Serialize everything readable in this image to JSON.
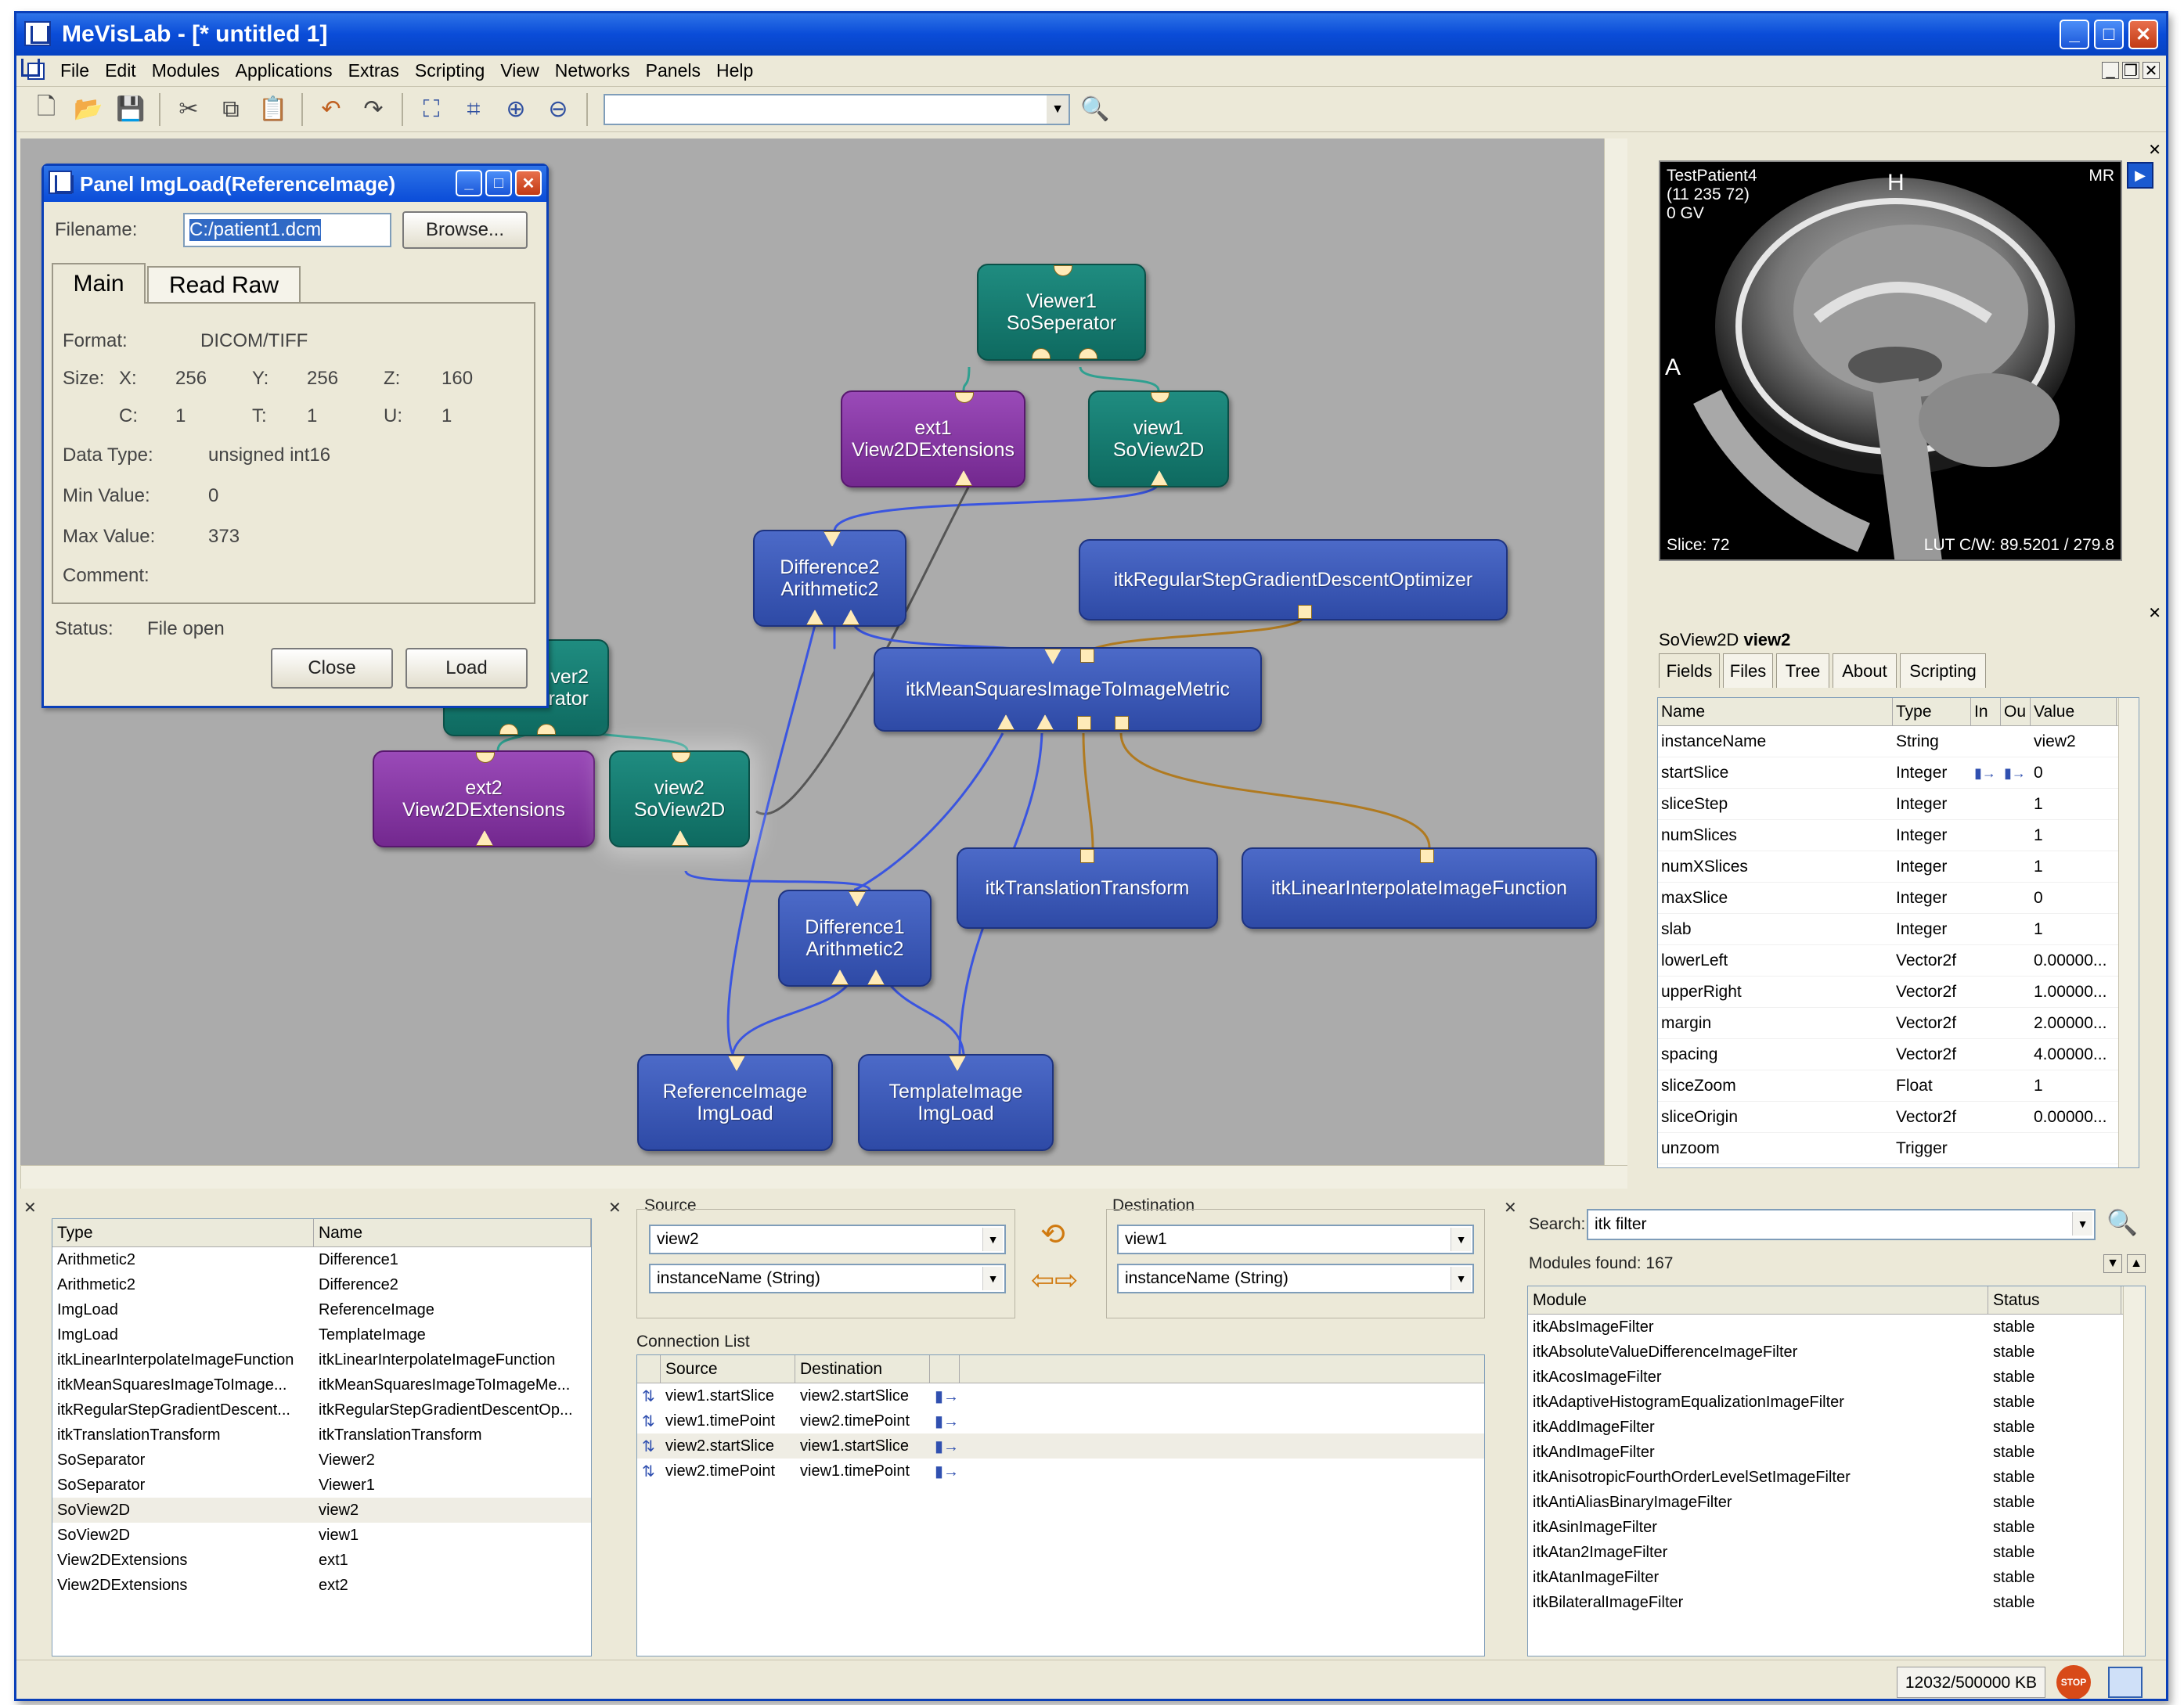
{
  "window": {
    "title": "MeVisLab - [* untitled 1]"
  },
  "menu": [
    "File",
    "Edit",
    "Modules",
    "Applications",
    "Extras",
    "Scripting",
    "View",
    "Networks",
    "Panels",
    "Help"
  ],
  "panel": {
    "title": "Panel ImgLoad(ReferenceImage)",
    "filename_label": "Filename:",
    "filename_value": "C:/patient1.dcm",
    "browse": "Browse...",
    "tabs": [
      "Main",
      "Read Raw"
    ],
    "format_label": "Format:",
    "format_value": "DICOM/TIFF",
    "size_label": "Size:",
    "x_label": "X:",
    "x": "256",
    "y_label": "Y:",
    "y": "256",
    "z_label": "Z:",
    "z": "160",
    "c_label": "C:",
    "c": "1",
    "t_label": "T:",
    "t": "1",
    "u_label": "U:",
    "u": "1",
    "datatype_label": "Data Type:",
    "datatype": "unsigned int16",
    "min_label": "Min Value:",
    "min": "0",
    "max_label": "Max Value:",
    "max": "373",
    "comment_label": "Comment:",
    "status_label": "Status:",
    "status": "File open",
    "close": "Close",
    "load": "Load"
  },
  "network": {
    "modules": [
      {
        "id": "viewer1",
        "l1": "Viewer1",
        "l2": "SoSeperator",
        "kind": "teal"
      },
      {
        "id": "ext1",
        "l1": "ext1",
        "l2": "View2DExtensions",
        "kind": "purple"
      },
      {
        "id": "view1",
        "l1": "view1",
        "l2": "SoView2D",
        "kind": "teal"
      },
      {
        "id": "diff2",
        "l1": "Difference2",
        "l2": "Arithmetic2",
        "kind": "blue"
      },
      {
        "id": "optimizer",
        "l1": "itkRegularStepGradientDescentOptimizer",
        "l2": "",
        "kind": "blue"
      },
      {
        "id": "metric",
        "l1": "itkMeanSquaresImageToImageMetric",
        "l2": "",
        "kind": "blue"
      },
      {
        "id": "viewer2",
        "l1": "ver2",
        "l2": "arator",
        "kind": "teal"
      },
      {
        "id": "ext2",
        "l1": "ext2",
        "l2": "View2DExtensions",
        "kind": "purple"
      },
      {
        "id": "view2",
        "l1": "view2",
        "l2": "SoView2D",
        "kind": "teal"
      },
      {
        "id": "translation",
        "l1": "itkTranslationTransform",
        "l2": "",
        "kind": "blue"
      },
      {
        "id": "interp",
        "l1": "itkLinearInterpolateImageFunction",
        "l2": "",
        "kind": "blue"
      },
      {
        "id": "diff1",
        "l1": "Difference1",
        "l2": "Arithmetic2",
        "kind": "blue"
      },
      {
        "id": "refimg",
        "l1": "ReferenceImage",
        "l2": "ImgLoad",
        "kind": "blue"
      },
      {
        "id": "tmplimg",
        "l1": "TemplateImage",
        "l2": "ImgLoad",
        "kind": "blue"
      }
    ]
  },
  "viewer": {
    "patient": "TestPatient4",
    "dims": "(11 235 72)",
    "gv": "0 GV",
    "modality": "MR",
    "orient_h": "H",
    "orient_a": "A",
    "slice": "Slice: 72",
    "lut": "LUT C/W: 89.5201 / 279.8"
  },
  "inspector": {
    "title_type": "SoView2D",
    "title_name": "view2",
    "tabs": [
      "Fields",
      "Files",
      "Tree",
      "About",
      "Scripting"
    ],
    "columns": [
      "Name",
      "Type",
      "In",
      "Ou",
      "Value"
    ],
    "rows": [
      [
        "instanceName",
        "String",
        "view2"
      ],
      [
        "startSlice",
        "Integer",
        "0"
      ],
      [
        "sliceStep",
        "Integer",
        "1"
      ],
      [
        "numSlices",
        "Integer",
        "1"
      ],
      [
        "numXSlices",
        "Integer",
        "1"
      ],
      [
        "maxSlice",
        "Integer",
        "0"
      ],
      [
        "slab",
        "Integer",
        "1"
      ],
      [
        "lowerLeft",
        "Vector2f",
        "0.00000..."
      ],
      [
        "upperRight",
        "Vector2f",
        "1.00000..."
      ],
      [
        "margin",
        "Vector2f",
        "2.00000..."
      ],
      [
        "spacing",
        "Vector2f",
        "4.00000..."
      ],
      [
        "sliceZoom",
        "Float",
        "1"
      ],
      [
        "sliceOrigin",
        "Vector2f",
        "0.00000..."
      ],
      [
        "unzoom",
        "Trigger",
        ""
      ]
    ]
  },
  "modlist": {
    "columns": [
      "Type",
      "Name"
    ],
    "rows": [
      [
        "Arithmetic2",
        "Difference1"
      ],
      [
        "Arithmetic2",
        "Difference2"
      ],
      [
        "ImgLoad",
        "ReferenceImage"
      ],
      [
        "ImgLoad",
        "TemplateImage"
      ],
      [
        "itkLinearInterpolateImageFunction",
        "itkLinearInterpolateImageFunction"
      ],
      [
        "itkMeanSquaresImageToImage...",
        "itkMeanSquaresImageToImageMe..."
      ],
      [
        "itkRegularStepGradientDescent...",
        "itkRegularStepGradientDescentOp..."
      ],
      [
        "itkTranslationTransform",
        "itkTranslationTransform"
      ],
      [
        "SoSeparator",
        "Viewer2"
      ],
      [
        "SoSeparator",
        "Viewer1"
      ],
      [
        "SoView2D",
        "view2"
      ],
      [
        "SoView2D",
        "view1"
      ],
      [
        "View2DExtensions",
        "ext1"
      ],
      [
        "View2DExtensions",
        "ext2"
      ]
    ]
  },
  "connections": {
    "source_label": "Source",
    "dest_label": "Destination",
    "source_module": "view2",
    "source_field": "instanceName (String)",
    "dest_module": "view1",
    "dest_field": "instanceName (String)",
    "list_label": "Connection List",
    "columns": [
      "Source",
      "Destination"
    ],
    "rows": [
      [
        "view1.startSlice",
        "view2.startSlice"
      ],
      [
        "view1.timePoint",
        "view2.timePoint"
      ],
      [
        "view2.startSlice",
        "view1.startSlice"
      ],
      [
        "view2.timePoint",
        "view1.timePoint"
      ]
    ]
  },
  "search": {
    "label": "Search:",
    "value": "itk filter",
    "found": "Modules found: 167",
    "columns": [
      "Module",
      "Status"
    ],
    "rows": [
      [
        "itkAbsImageFilter",
        "stable"
      ],
      [
        "itkAbsoluteValueDifferenceImageFilter",
        "stable"
      ],
      [
        "itkAcosImageFilter",
        "stable"
      ],
      [
        "itkAdaptiveHistogramEqualizationImageFilter",
        "stable"
      ],
      [
        "itkAddImageFilter",
        "stable"
      ],
      [
        "itkAndImageFilter",
        "stable"
      ],
      [
        "itkAnisotropicFourthOrderLevelSetImageFilter",
        "stable"
      ],
      [
        "itkAntiAliasBinaryImageFilter",
        "stable"
      ],
      [
        "itkAsinImageFilter",
        "stable"
      ],
      [
        "itkAtan2ImageFilter",
        "stable"
      ],
      [
        "itkAtanImageFilter",
        "stable"
      ],
      [
        "itkBilateralImageFilter",
        "stable"
      ]
    ]
  },
  "status": {
    "memory": "12032/500000 KB",
    "stop": "STOP"
  }
}
